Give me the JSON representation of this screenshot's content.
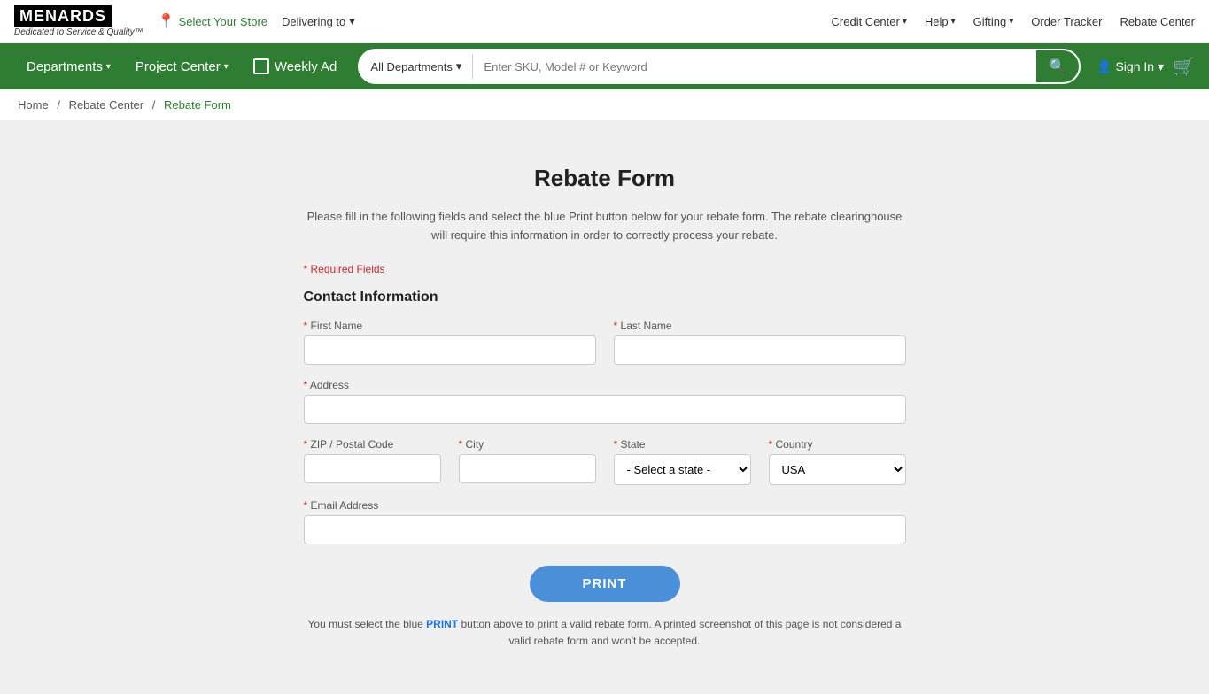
{
  "topbar": {
    "logo": "MENARDS",
    "tagline": "Dedicated to Service & Quality™",
    "store_label": "Select Your Store",
    "delivering_label": "Delivering to",
    "links": [
      {
        "label": "Credit Center",
        "has_chevron": true
      },
      {
        "label": "Help",
        "has_chevron": true
      },
      {
        "label": "Gifting",
        "has_chevron": true
      },
      {
        "label": "Order Tracker",
        "has_chevron": false
      },
      {
        "label": "Rebate Center",
        "has_chevron": false
      }
    ]
  },
  "navbar": {
    "departments_label": "Departments",
    "project_center_label": "Project Center",
    "weekly_ad_label": "Weekly Ad",
    "search": {
      "dept_label": "All Departments",
      "placeholder": "Enter SKU, Model # or Keyword"
    },
    "sign_in_label": "Sign In"
  },
  "breadcrumb": {
    "home": "Home",
    "rebate_center": "Rebate Center",
    "current": "Rebate Form"
  },
  "form": {
    "title": "Rebate Form",
    "description": "Please fill in the following fields and select the blue Print button below for your rebate form. The rebate clearinghouse will require this information in order to correctly process your rebate.",
    "required_note": "* Required Fields",
    "section_title": "Contact Information",
    "fields": {
      "first_name_label": "First Name",
      "last_name_label": "Last Name",
      "address_label": "Address",
      "zip_label": "ZIP / Postal Code",
      "city_label": "City",
      "state_label": "State",
      "state_placeholder": "- Select a state -",
      "country_label": "Country",
      "country_default": "USA",
      "email_label": "Email Address"
    },
    "print_button": "PRINT",
    "print_note": "You must select the blue PRINT button above to print a valid rebate form. A printed screenshot of this page is not considered a valid rebate form and won't be accepted."
  }
}
